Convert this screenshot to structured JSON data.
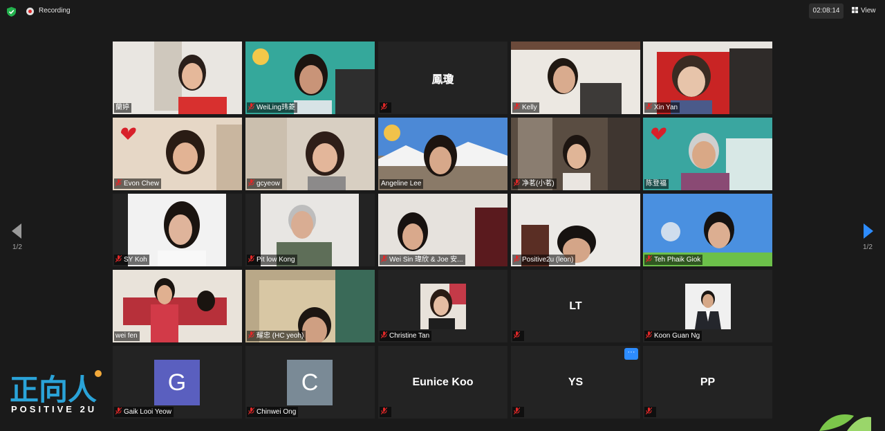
{
  "topbar": {
    "recording_label": "Recording",
    "timer": "02:08:14",
    "view_label": "View"
  },
  "pager": {
    "left": "1/2",
    "right": "1/2"
  },
  "participants": [
    {
      "name": "蘭婷",
      "muted": false
    },
    {
      "name": "WeiLing玮菱",
      "muted": true
    },
    {
      "name": "鳳瓊",
      "muted": true,
      "display_text": "鳳瓊"
    },
    {
      "name": "Kelly",
      "muted": true
    },
    {
      "name": "Xin Yan",
      "muted": true
    },
    {
      "name": "Evon Chew",
      "muted": true
    },
    {
      "name": "gcyeow",
      "muted": true
    },
    {
      "name": "Angeline Lee",
      "muted": false
    },
    {
      "name": "净茗(小茗)",
      "muted": true
    },
    {
      "name": "陈登福",
      "muted": false,
      "active_speaker": true
    },
    {
      "name": "SY Koh",
      "muted": true
    },
    {
      "name": "Pit low Kong",
      "muted": true
    },
    {
      "name": "Wei Sin 瑋欣 & Joe 安...",
      "muted": true
    },
    {
      "name": "Positive2u (leon)",
      "muted": true
    },
    {
      "name": "Teh Phaik Giok",
      "muted": true
    },
    {
      "name": "wei fen",
      "muted": false
    },
    {
      "name": "耀忠 (HC yeoh)",
      "muted": true
    },
    {
      "name": "Christine Tan",
      "muted": true
    },
    {
      "name": "",
      "muted": true,
      "display_text": "LT"
    },
    {
      "name": "Koon Guan Ng",
      "muted": true
    },
    {
      "name": "Gaik Looi Yeow",
      "muted": true,
      "avatar_letter": "G",
      "avatar_color": "#5a5fbf"
    },
    {
      "name": "Chinwei Ong",
      "muted": true,
      "avatar_letter": "C",
      "avatar_color": "#7a8a96"
    },
    {
      "name": "",
      "muted": true,
      "display_text": "Eunice Koo"
    },
    {
      "name": "",
      "muted": true,
      "display_text": "YS"
    },
    {
      "name": "",
      "muted": true,
      "display_text": "PP"
    }
  ],
  "more_button": "···",
  "logo": {
    "chars": "正向人",
    "subtitle": "POSITIVE 2U"
  },
  "colors": {
    "accent": "#2d8cff",
    "active_border": "#c5d93a",
    "mute_red": "#e02828"
  }
}
